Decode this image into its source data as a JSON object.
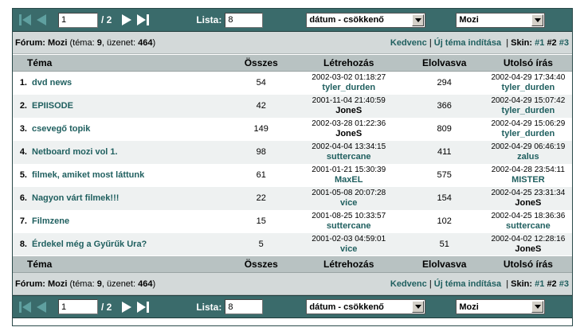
{
  "toolbar": {
    "page_value": "1",
    "page_total": "/ 2",
    "list_label": "Lista:",
    "list_value": "8",
    "sort_value": "dátum - csökkenő",
    "category_value": "Mozi"
  },
  "info": {
    "forum_label": "Fórum:",
    "forum_name": "Mozi",
    "stats_prefix": "(téma:",
    "topic_count": "9",
    "stats_mid": ", üzenet:",
    "message_count": "464",
    "stats_suffix": ")",
    "favorite": "Kedvenc",
    "new_topic": "Új téma indítása",
    "skin_label": "Skin:",
    "skin1": "#1",
    "skin2": "#2",
    "skin3": "#3"
  },
  "columns": {
    "topic": "Téma",
    "total": "Összes",
    "created": "Létrehozás",
    "read": "Elolvasva",
    "last": "Utolsó írás"
  },
  "rows": [
    {
      "num": "1.",
      "title": "dvd news",
      "total": "54",
      "created_date": "2002-03-02 01:18:27",
      "created_user": "tyler_durden",
      "read": "294",
      "last_date": "2002-04-29 17:34:40",
      "last_user": "tyler_durden"
    },
    {
      "num": "2.",
      "title": "EPIISODE",
      "total": "42",
      "created_date": "2001-11-04 21:40:59",
      "created_user": "JoneS",
      "read": "366",
      "last_date": "2002-04-29 15:07:42",
      "last_user": "tyler_durden"
    },
    {
      "num": "3.",
      "title": "csevegő topik",
      "total": "149",
      "created_date": "2002-03-28 01:22:36",
      "created_user": "JoneS",
      "read": "809",
      "last_date": "2002-04-29 15:06:29",
      "last_user": "tyler_durden"
    },
    {
      "num": "4.",
      "title": "Netboard mozi vol 1.",
      "total": "98",
      "created_date": "2002-04-04 13:34:15",
      "created_user": "suttercane",
      "read": "411",
      "last_date": "2002-04-29 06:46:19",
      "last_user": "zalus"
    },
    {
      "num": "5.",
      "title": "filmek, amiket most láttunk",
      "total": "61",
      "created_date": "2001-01-21 15:30:39",
      "created_user": "MaxEL",
      "read": "575",
      "last_date": "2002-04-28 23:54:11",
      "last_user": "MISTER"
    },
    {
      "num": "6.",
      "title": "Nagyon várt filmek!!!",
      "total": "22",
      "created_date": "2001-05-08 20:07:28",
      "created_user": "vice",
      "read": "154",
      "last_date": "2002-04-25 23:31:34",
      "last_user": "JoneS"
    },
    {
      "num": "7.",
      "title": "Filmzene",
      "total": "15",
      "created_date": "2001-08-25 10:33:57",
      "created_user": "suttercane",
      "read": "102",
      "last_date": "2002-04-25 18:36:36",
      "last_user": "suttercane"
    },
    {
      "num": "8.",
      "title": "Érdekel még a Gyűrűk Ura?",
      "total": "5",
      "created_date": "2001-02-03 04:59:01",
      "created_user": "vice",
      "read": "51",
      "last_date": "2002-04-02 12:28:16",
      "last_user": "JoneS"
    }
  ],
  "colors": {
    "toolbar_bg": "#3a6b6b",
    "link": "#1f5f5f",
    "header_bg": "#b8c2c2",
    "infobar_bg": "#d3d9d9"
  }
}
